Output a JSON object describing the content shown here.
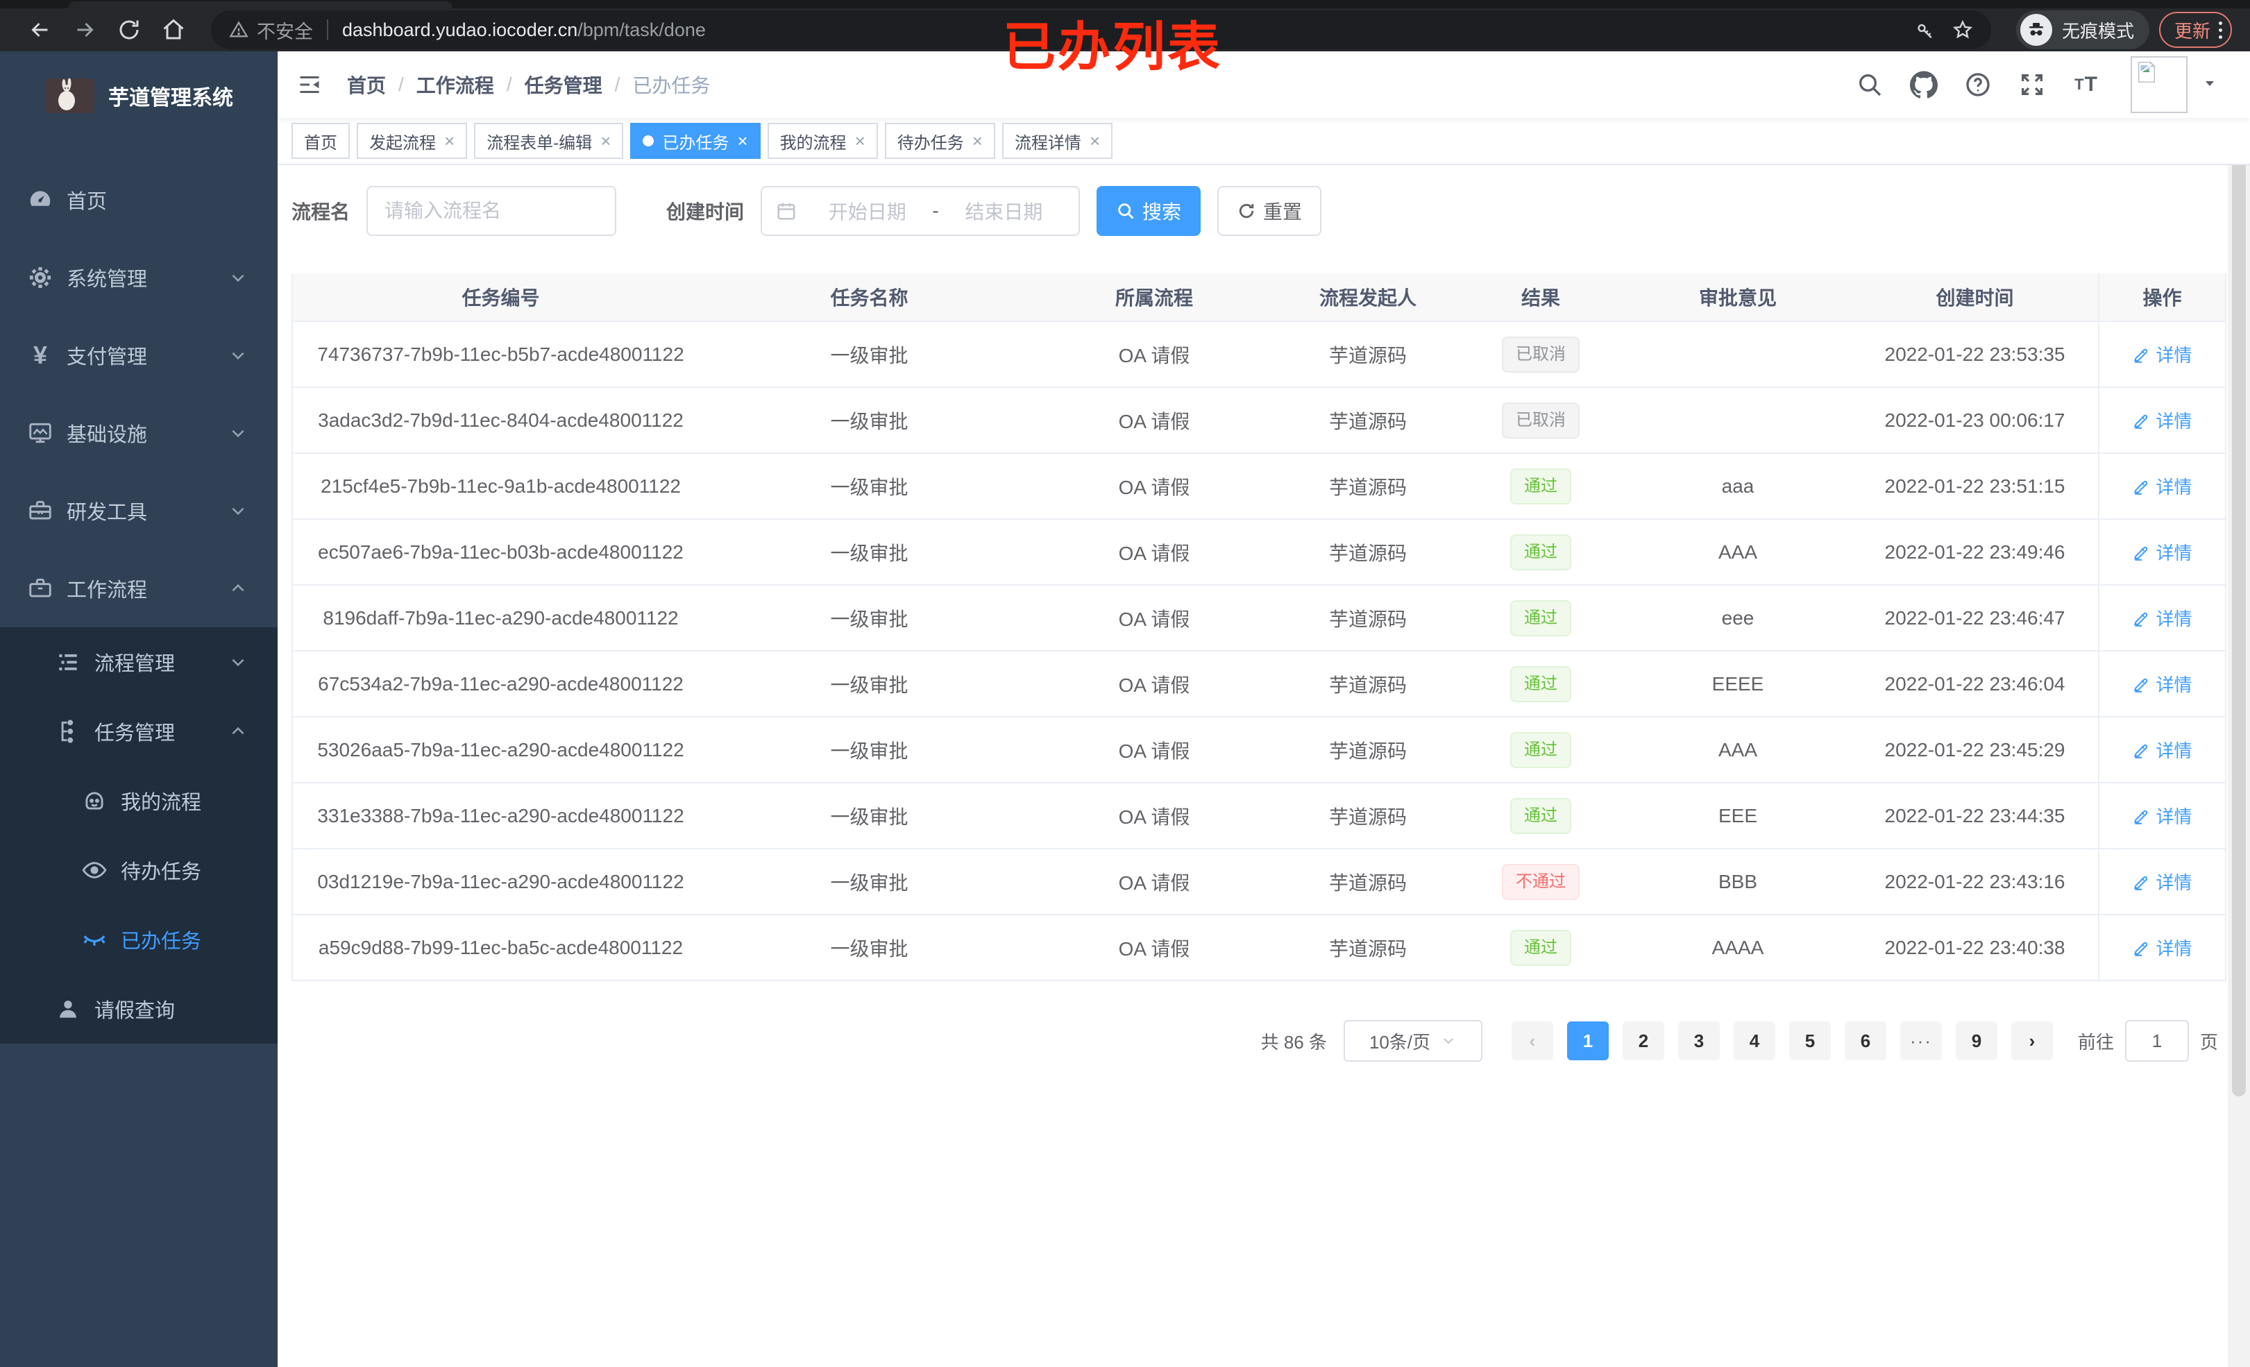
{
  "browser": {
    "security_label": "不安全",
    "url_host": "dashboard.yudao.iocoder.cn",
    "url_path": "/bpm/task/done",
    "incognito_label": "无痕模式",
    "update_label": "更新"
  },
  "annotation": {
    "text": "已办列表",
    "color": "#ff2b0e"
  },
  "sidebar": {
    "title": "芋道管理系统",
    "items": [
      {
        "key": "home",
        "label": "首页",
        "icon": "dashboard-icon",
        "level": 1,
        "sub": false,
        "arrow": null,
        "active": false
      },
      {
        "key": "system",
        "label": "系统管理",
        "icon": "gear-icon",
        "level": 1,
        "sub": false,
        "arrow": "down",
        "active": false
      },
      {
        "key": "payment",
        "label": "支付管理",
        "icon": "yen-icon",
        "level": 1,
        "sub": false,
        "arrow": "down",
        "active": false
      },
      {
        "key": "infra",
        "label": "基础设施",
        "icon": "monitor-icon",
        "level": 1,
        "sub": false,
        "arrow": "down",
        "active": false
      },
      {
        "key": "devtools",
        "label": "研发工具",
        "icon": "toolbox-icon",
        "level": 1,
        "sub": false,
        "arrow": "down",
        "active": false
      },
      {
        "key": "workflow",
        "label": "工作流程",
        "icon": "briefcase-icon",
        "level": 1,
        "sub": false,
        "arrow": "up",
        "active": false
      },
      {
        "key": "process-mgmt",
        "label": "流程管理",
        "icon": "list-tree-icon",
        "level": 2,
        "sub": true,
        "arrow": "down",
        "active": false
      },
      {
        "key": "task-mgmt",
        "label": "任务管理",
        "icon": "org-tree-icon",
        "level": 2,
        "sub": true,
        "arrow": "up",
        "active": false
      },
      {
        "key": "my-process",
        "label": "我的流程",
        "icon": "robot-icon",
        "level": 3,
        "sub": true,
        "arrow": null,
        "active": false
      },
      {
        "key": "todo-tasks",
        "label": "待办任务",
        "icon": "eye-icon",
        "level": 3,
        "sub": true,
        "arrow": null,
        "active": false
      },
      {
        "key": "done-tasks",
        "label": "已办任务",
        "icon": "eye-closed-icon",
        "level": 3,
        "sub": true,
        "arrow": null,
        "active": true
      },
      {
        "key": "leave-query",
        "label": "请假查询",
        "icon": "user-icon",
        "level": 2,
        "sub": true,
        "arrow": null,
        "active": false
      }
    ]
  },
  "header": {
    "breadcrumb": [
      "首页",
      "工作流程",
      "任务管理",
      "已办任务"
    ]
  },
  "tags": [
    {
      "key": "home",
      "label": "首页",
      "closable": false,
      "active": false
    },
    {
      "key": "launch-process",
      "label": "发起流程",
      "closable": true,
      "active": false
    },
    {
      "key": "form-edit",
      "label": "流程表单-编辑",
      "closable": true,
      "active": false
    },
    {
      "key": "done-tasks",
      "label": "已办任务",
      "closable": true,
      "active": true
    },
    {
      "key": "my-process",
      "label": "我的流程",
      "closable": true,
      "active": false
    },
    {
      "key": "todo-tasks",
      "label": "待办任务",
      "closable": true,
      "active": false
    },
    {
      "key": "process-detail",
      "label": "流程详情",
      "closable": true,
      "active": false
    }
  ],
  "filters": {
    "name_label": "流程名",
    "name_placeholder": "请输入流程名",
    "time_label": "创建时间",
    "start_placeholder": "开始日期",
    "range_separator": "-",
    "end_placeholder": "结束日期",
    "search_label": "搜索",
    "reset_label": "重置"
  },
  "table": {
    "columns": [
      "任务编号",
      "任务名称",
      "所属流程",
      "流程发起人",
      "结果",
      "审批意见",
      "创建时间",
      "操作"
    ],
    "action_label": "详情",
    "rows": [
      {
        "id": "74736737-7b9b-11ec-b5b7-acde48001122",
        "name": "一级审批",
        "process": "OA 请假",
        "starter": "芋道源码",
        "result": "已取消",
        "result_type": "info",
        "comment": "",
        "created": "2022-01-22 23:53:35"
      },
      {
        "id": "3adac3d2-7b9d-11ec-8404-acde48001122",
        "name": "一级审批",
        "process": "OA 请假",
        "starter": "芋道源码",
        "result": "已取消",
        "result_type": "info",
        "comment": "",
        "created": "2022-01-23 00:06:17"
      },
      {
        "id": "215cf4e5-7b9b-11ec-9a1b-acde48001122",
        "name": "一级审批",
        "process": "OA 请假",
        "starter": "芋道源码",
        "result": "通过",
        "result_type": "success",
        "comment": "aaa",
        "created": "2022-01-22 23:51:15"
      },
      {
        "id": "ec507ae6-7b9a-11ec-b03b-acde48001122",
        "name": "一级审批",
        "process": "OA 请假",
        "starter": "芋道源码",
        "result": "通过",
        "result_type": "success",
        "comment": "AAA",
        "created": "2022-01-22 23:49:46"
      },
      {
        "id": "8196daff-7b9a-11ec-a290-acde48001122",
        "name": "一级审批",
        "process": "OA 请假",
        "starter": "芋道源码",
        "result": "通过",
        "result_type": "success",
        "comment": "eee",
        "created": "2022-01-22 23:46:47"
      },
      {
        "id": "67c534a2-7b9a-11ec-a290-acde48001122",
        "name": "一级审批",
        "process": "OA 请假",
        "starter": "芋道源码",
        "result": "通过",
        "result_type": "success",
        "comment": "EEEE",
        "created": "2022-01-22 23:46:04"
      },
      {
        "id": "53026aa5-7b9a-11ec-a290-acde48001122",
        "name": "一级审批",
        "process": "OA 请假",
        "starter": "芋道源码",
        "result": "通过",
        "result_type": "success",
        "comment": "AAA",
        "created": "2022-01-22 23:45:29"
      },
      {
        "id": "331e3388-7b9a-11ec-a290-acde48001122",
        "name": "一级审批",
        "process": "OA 请假",
        "starter": "芋道源码",
        "result": "通过",
        "result_type": "success",
        "comment": "EEE",
        "created": "2022-01-22 23:44:35"
      },
      {
        "id": "03d1219e-7b9a-11ec-a290-acde48001122",
        "name": "一级审批",
        "process": "OA 请假",
        "starter": "芋道源码",
        "result": "不通过",
        "result_type": "danger",
        "comment": "BBB",
        "created": "2022-01-22 23:43:16"
      },
      {
        "id": "a59c9d88-7b99-11ec-ba5c-acde48001122",
        "name": "一级审批",
        "process": "OA 请假",
        "starter": "芋道源码",
        "result": "通过",
        "result_type": "success",
        "comment": "AAAA",
        "created": "2022-01-22 23:40:38"
      }
    ]
  },
  "pagination": {
    "total_label": "共 86 条",
    "page_size": "10条/页",
    "prev": "‹",
    "next": "›",
    "pages": [
      "1",
      "2",
      "3",
      "4",
      "5",
      "6",
      "···",
      "9"
    ],
    "active_page": "1",
    "jump_prefix": "前往",
    "jump_value": "1",
    "jump_suffix": "页"
  },
  "colors": {
    "accent": "#409eff",
    "success": "#67c23a",
    "danger": "#f56c6c",
    "info": "#909399",
    "sidebar": "#304156",
    "submenu": "#1f2d3d"
  }
}
